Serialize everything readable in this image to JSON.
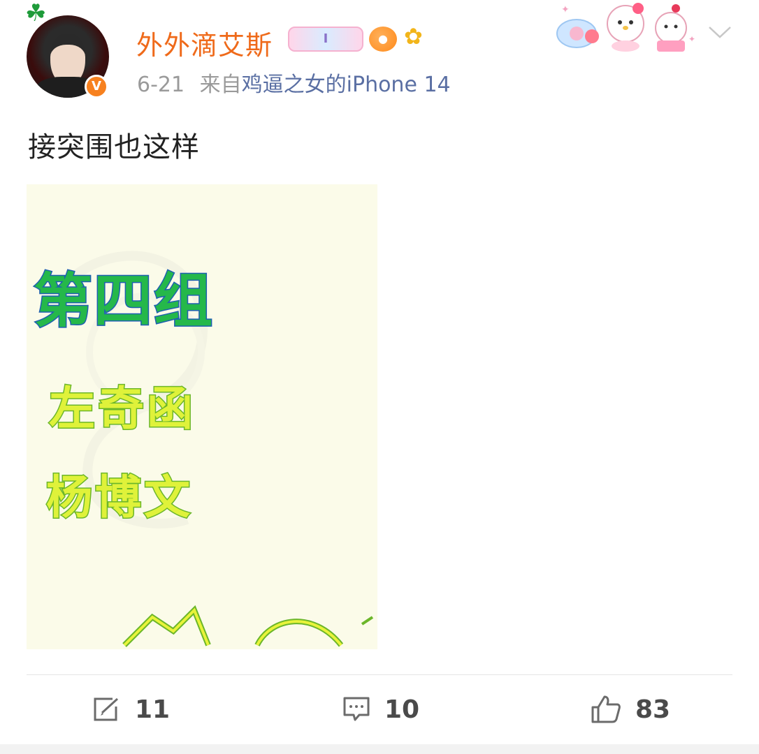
{
  "header": {
    "username": "外外滴艾斯",
    "badge_label": "I",
    "time": "6-21",
    "from_prefix": "来自",
    "source": "鸡逼之女的iPhone 14",
    "verified_label": "V"
  },
  "post": {
    "text": "接突围也这样",
    "image": {
      "title": "第四组",
      "name1": "左奇函",
      "name2": "杨博文"
    }
  },
  "actions": {
    "repost_count": "11",
    "comment_count": "10",
    "like_count": "83"
  },
  "icons": [
    "clover-icon",
    "badge-icon",
    "fish-icon",
    "sunflower-icon",
    "hello-kitty-decoration",
    "chevron-down-icon",
    "repost-icon",
    "comment-icon",
    "like-icon"
  ],
  "colors": {
    "username": "#ef6a1a",
    "source_link": "#5a6fa3",
    "meta": "#9a9a9a",
    "verified_badge": "#f7811f"
  }
}
